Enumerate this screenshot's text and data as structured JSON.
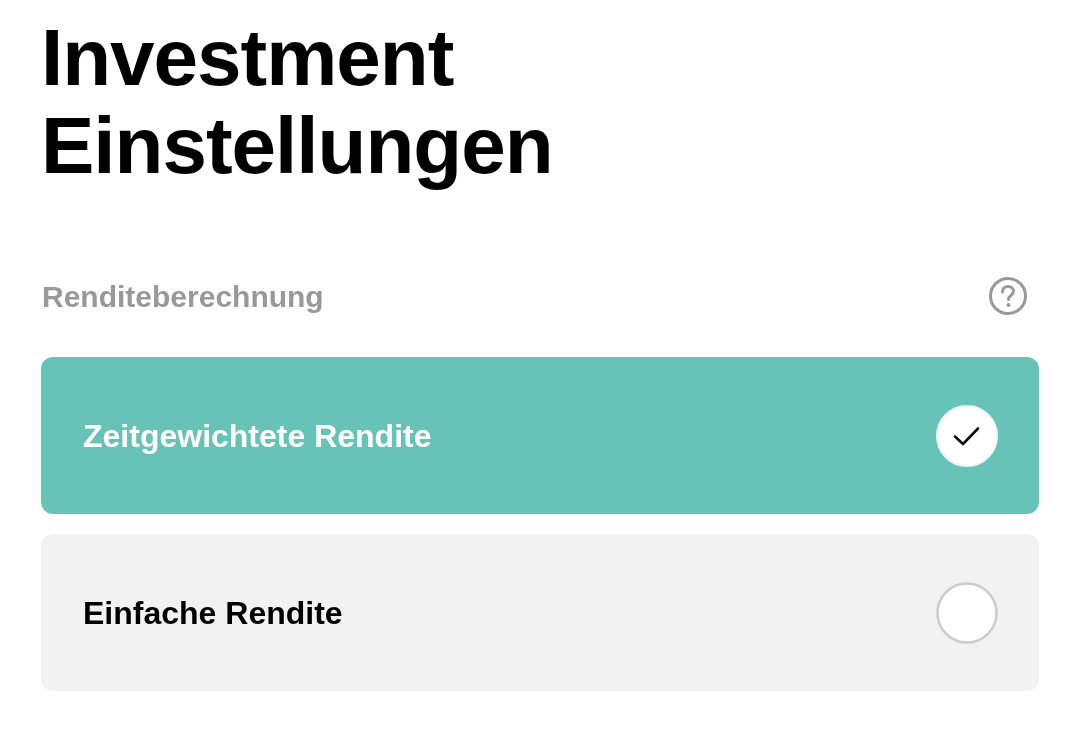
{
  "title": "Investment Einstellungen",
  "section": {
    "label": "Renditeberechnung"
  },
  "options": [
    {
      "label": "Zeitgewichtete Rendite",
      "selected": true
    },
    {
      "label": "Einfache Rendite",
      "selected": false
    }
  ]
}
